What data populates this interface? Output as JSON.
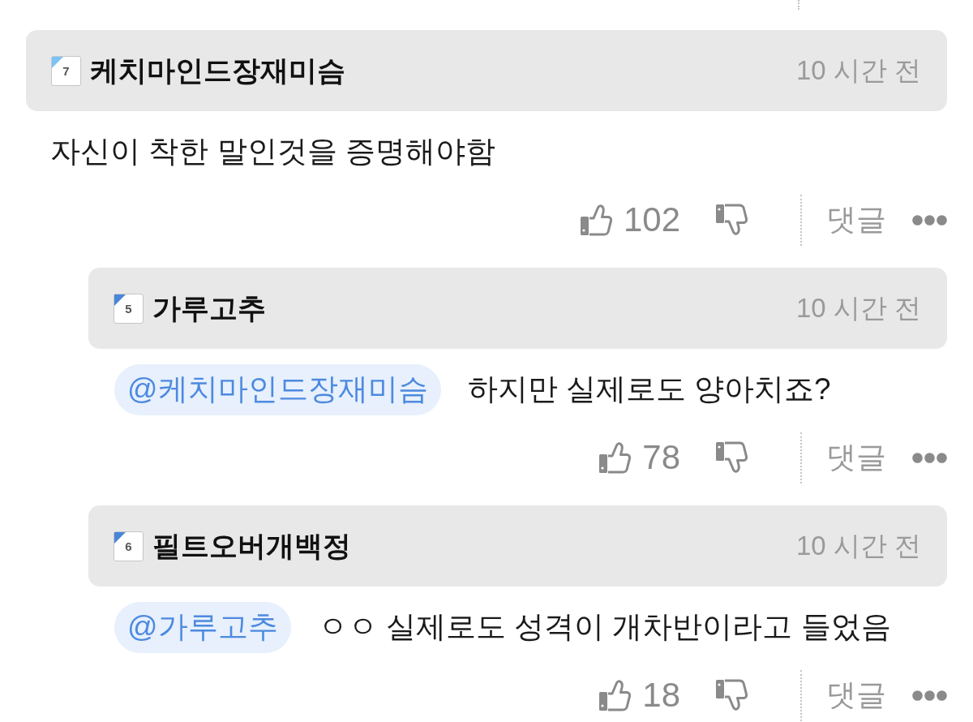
{
  "comments": [
    {
      "author": {
        "name": "케치마인드장재미슴",
        "grade": "7",
        "color": "#7cc3f5"
      },
      "time": "10 시간 전",
      "text": "자신이 착한 말인것을 증명해야함",
      "likes": "102",
      "reply_label": "댓글",
      "replies": [
        {
          "author": {
            "name": "가루고추",
            "grade": "5",
            "color": "#4a86d8"
          },
          "time": "10 시간 전",
          "mention": "@케치마인드장재미슴",
          "text": "하지만 실제로도 양아치죠?",
          "likes": "78",
          "reply_label": "댓글"
        },
        {
          "author": {
            "name": "필트오버개백정",
            "grade": "6",
            "color": "#4a86d8"
          },
          "time": "10 시간 전",
          "mention": "@가루고추",
          "text": "ㅇㅇ 실제로도 성격이 개차반이라고 들었음",
          "likes": "18",
          "reply_label": "댓글"
        }
      ]
    }
  ]
}
